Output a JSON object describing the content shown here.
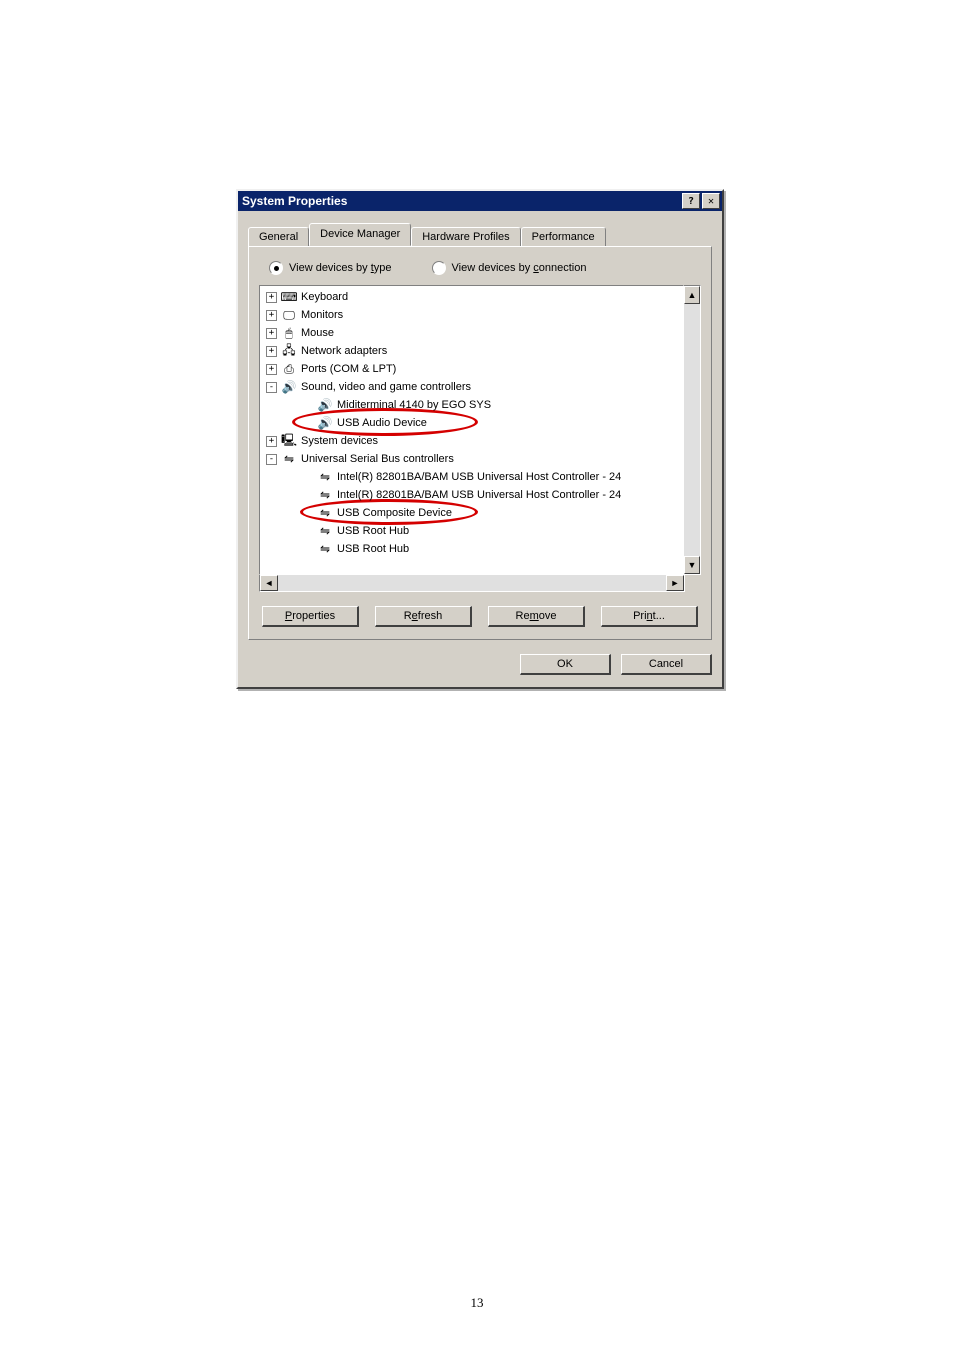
{
  "dialog": {
    "title": "System Properties",
    "tabs": {
      "general": "General",
      "device_manager": "Device Manager",
      "hardware_profiles": "Hardware Profiles",
      "performance": "Performance",
      "active": "device_manager"
    },
    "view": {
      "by_type": "View devices by type",
      "by_connection": "View devices by connection",
      "by_type_ul": "t",
      "by_connection_ul": "c",
      "selected": "type"
    },
    "buttons": {
      "properties": "Properties",
      "refresh": "Refresh",
      "remove": "Remove",
      "print": "Print...",
      "ok": "OK",
      "cancel": "Cancel"
    }
  },
  "tree": [
    {
      "expand": "+",
      "icon": "keyboard",
      "label": "Keyboard",
      "level": 1
    },
    {
      "expand": "+",
      "icon": "monitor",
      "label": "Monitors",
      "level": 1
    },
    {
      "expand": "+",
      "icon": "mouse",
      "label": "Mouse",
      "level": 1
    },
    {
      "expand": "+",
      "icon": "network",
      "label": "Network adapters",
      "level": 1
    },
    {
      "expand": "+",
      "icon": "ports",
      "label": "Ports (COM & LPT)",
      "level": 1
    },
    {
      "expand": "-",
      "icon": "sound",
      "label": "Sound, video and game controllers",
      "level": 1
    },
    {
      "expand": "",
      "icon": "sound",
      "label": "Miditerminal 4140 by EGO SYS",
      "level": 2
    },
    {
      "expand": "",
      "icon": "sound",
      "label": "USB Audio Device",
      "level": 2,
      "highlight": "hl1"
    },
    {
      "expand": "+",
      "icon": "system",
      "label": "System devices",
      "level": 1
    },
    {
      "expand": "-",
      "icon": "usb",
      "label": "Universal Serial Bus controllers",
      "level": 1
    },
    {
      "expand": "",
      "icon": "usb",
      "label": "Intel(R) 82801BA/BAM USB Universal Host Controller - 24",
      "level": 2
    },
    {
      "expand": "",
      "icon": "usb",
      "label": "Intel(R) 82801BA/BAM USB Universal Host Controller - 24",
      "level": 2
    },
    {
      "expand": "",
      "icon": "usb",
      "label": "USB Composite Device",
      "level": 2,
      "highlight": "hl2"
    },
    {
      "expand": "",
      "icon": "usb",
      "label": "USB Root Hub",
      "level": 2
    },
    {
      "expand": "",
      "icon": "usb",
      "label": "USB Root Hub",
      "level": 2
    }
  ],
  "icons": {
    "keyboard": "⌨",
    "monitor": "🖵",
    "mouse": "🖱",
    "network": "🖧",
    "ports": "⎙",
    "sound": "🔊",
    "system": "🖳",
    "usb": "⇋"
  },
  "page_number": "13"
}
